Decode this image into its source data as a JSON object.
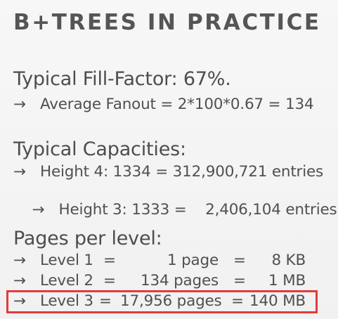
{
  "slide": {
    "title": "B+TREES IN PRACTICE",
    "fill_factor": {
      "heading": "Typical Fill-Factor: 67%.",
      "fanout_line": "Average Fanout = 2*100*0.67 = 134"
    },
    "capacities": {
      "heading": "Typical Capacities:",
      "lines": [
        "Height 4: 1334 = 312,900,721 entries",
        "Height 3: 1333 =    2,406,104 entries"
      ]
    },
    "pages_per_level": {
      "heading": "Pages per level:",
      "rows": [
        {
          "level": "Level 1",
          "eq1": "=",
          "pages": "1 page",
          "eq2": "=",
          "size": "8 KB"
        },
        {
          "level": "Level 2",
          "eq1": "=",
          "pages": "134 pages",
          "eq2": "=",
          "size": "1 MB"
        },
        {
          "level": "Level 3",
          "eq1": "=",
          "pages": "17,956 pages",
          "eq2": "=",
          "size": "140 MB"
        }
      ]
    },
    "arrow_glyph": "→",
    "highlight_color": "#e43b3b"
  }
}
